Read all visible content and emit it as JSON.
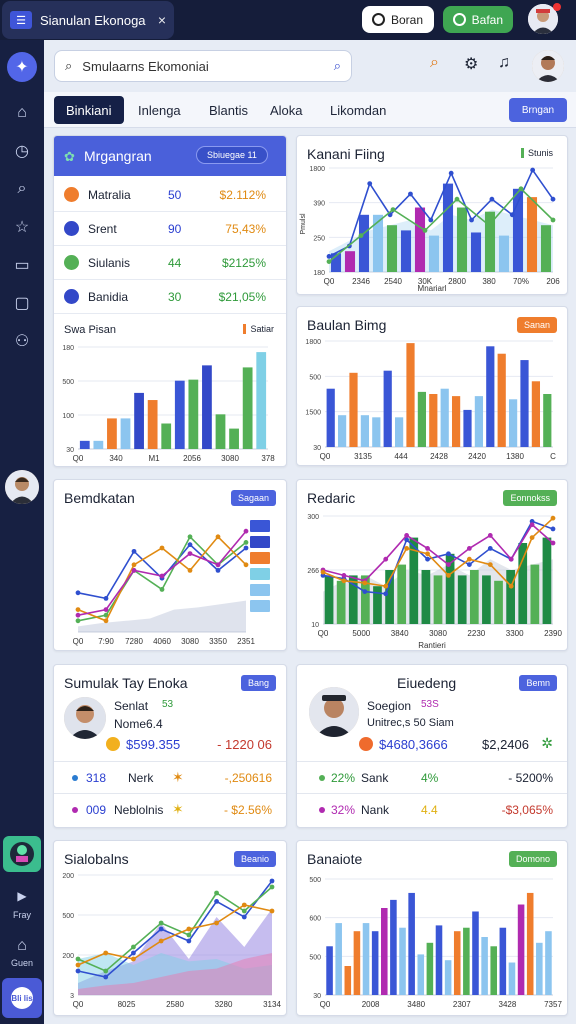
{
  "window": {
    "title": "Sianulan Ekonoga",
    "button_left": "Boran",
    "button_right": "Bafan",
    "icon_glyph": "☰",
    "close_glyph": "×"
  },
  "rail": {
    "labels": [
      "Fray",
      "Guen"
    ],
    "bottom": "Bli lis"
  },
  "search": {
    "value": "Smulaarns Ekomoniai"
  },
  "tabs": {
    "items": [
      "Binkiani",
      "Inlenga",
      "Blantis",
      "Aloka",
      "Likomdan"
    ],
    "button": "Brngan"
  },
  "card1": {
    "title": "Mrgangran",
    "badge": "Sbiuegae 11",
    "rows": [
      {
        "name": "Matralia",
        "value": "50",
        "pct": "$2.112%",
        "color": "#ef7d2d"
      },
      {
        "name": "Srent",
        "value": "90",
        "pct": "75,43%",
        "color": "#3348c8"
      },
      {
        "name": "Siulanis",
        "value": "44",
        "pct": "$2125%",
        "color": "#54b056"
      },
      {
        "name": "Banidia",
        "value": "30",
        "pct": "$21,05%",
        "color": "#3348c8"
      }
    ],
    "subtitle": "Swa Pisan",
    "legend": "Satiar"
  },
  "card2": {
    "title": "Kanani Fiing",
    "legend": "Stunis",
    "xlabel": "Mnariarl",
    "ylabel": "Pmulsl"
  },
  "card3": {
    "title": "Baulan Bimg",
    "badge": "Sanan"
  },
  "card4": {
    "title": "Bemdkatan",
    "badge": "Sagaan"
  },
  "card5": {
    "title": "Redaric",
    "badge": "Eonnokss",
    "xlabel": "Rantieri"
  },
  "card6": {
    "title": "Sumulak Tay Enoka",
    "badge": "Bang",
    "person": "Senlat",
    "person_tag": "53",
    "sub": "Nome6.4",
    "amount": "$599.355",
    "amount2": "- 1220 06",
    "rows": [
      {
        "v": "318",
        "n": "Nerk",
        "p": "-,250616",
        "color": "#2a7bd0"
      },
      {
        "v": "009",
        "n": "Neblolnis",
        "p": "- $2.56%",
        "color": "#b02ab0"
      }
    ]
  },
  "card7": {
    "title": "Eiuedeng",
    "badge": "Bemn",
    "person": "Soegion",
    "person_tag": "53S",
    "sub": "Unitrec,s 50 Siam",
    "amount": "$4680,3666",
    "amount2": "$2,2406",
    "rows": [
      {
        "v": "22%",
        "n": "Sank",
        "p2": "4%",
        "p": "- 5200%",
        "color": "#54b056"
      },
      {
        "v": "32%",
        "n": "Nank",
        "p2": "4.4",
        "p": "-$3,065%",
        "color": "#b02ab0"
      }
    ]
  },
  "card8": {
    "title": "Sialobalns",
    "badge": "Beanio"
  },
  "card9": {
    "title": "Banaiote",
    "badge": "Domono"
  },
  "chart_data": [
    {
      "id": "c1",
      "type": "bar",
      "title": "Swa Pisan",
      "yticks": [
        "180",
        "500",
        "100",
        "30"
      ],
      "xticks": [
        "Q0",
        "340",
        "M1",
        "2056",
        "3080",
        "378"
      ],
      "values": [
        0.08,
        0.08,
        0.3,
        0.3,
        0.55,
        0.48,
        0.25,
        0.67,
        0.68,
        0.82,
        0.34,
        0.2,
        0.8,
        0.95
      ],
      "colors": [
        "#3a56d6",
        "#8cc5ef",
        "#ef7d2d",
        "#8cc5ef",
        "#3348c8",
        "#ef7d2d",
        "#54b056",
        "#3a56d6",
        "#54b056",
        "#3348c8",
        "#54b056",
        "#54b056",
        "#54b056",
        "#7fd0e6"
      ]
    },
    {
      "id": "c2",
      "type": "bar",
      "title": "Kanani Fiing",
      "yticks": [
        "1800",
        "390",
        "250",
        "180"
      ],
      "xticks": [
        "Q0",
        "2346",
        "2540",
        "30K",
        "2800",
        "380",
        "70%",
        "206"
      ],
      "values": [
        0.18,
        0.2,
        0.55,
        0.55,
        0.45,
        0.4,
        0.62,
        0.35,
        0.85,
        0.62,
        0.38,
        0.58,
        0.35,
        0.8,
        0.72,
        0.45
      ],
      "colors": [
        "#3a56d6",
        "#b02ab0",
        "#3a56d6",
        "#8cc5ef",
        "#54b056",
        "#3a56d6",
        "#b02ab0",
        "#8cc5ef",
        "#3a56d6",
        "#54b056",
        "#3a56d6",
        "#54b056",
        "#8cc5ef",
        "#3a56d6",
        "#ef7d2d",
        "#54b056"
      ],
      "line": [
        0.15,
        0.25,
        0.85,
        0.55,
        0.75,
        0.5,
        0.95,
        0.5,
        0.7,
        0.55,
        0.98,
        0.7
      ],
      "line2": [
        0.1,
        0.35,
        0.6,
        0.4,
        0.7,
        0.45,
        0.8,
        0.5
      ]
    },
    {
      "id": "c3",
      "type": "bar",
      "title": "Baulan Bimg",
      "yticks": [
        "1800",
        "500",
        "1500",
        "30"
      ],
      "xticks": [
        "Q0",
        "3135",
        "444",
        "2428",
        "2420",
        "1380",
        "C"
      ],
      "values": [
        0.55,
        0.3,
        0.7,
        0.3,
        0.28,
        0.72,
        0.28,
        0.98,
        0.52,
        0.5,
        0.55,
        0.48,
        0.35,
        0.48,
        0.95,
        0.88,
        0.45,
        0.82,
        0.62,
        0.5
      ],
      "colors": [
        "#3a56d6",
        "#8cc5ef",
        "#ef7d2d",
        "#8cc5ef",
        "#8cc5ef",
        "#3a56d6",
        "#8cc5ef",
        "#ef7d2d",
        "#54b056",
        "#ef7d2d",
        "#8cc5ef",
        "#ef7d2d",
        "#3a56d6",
        "#8cc5ef",
        "#3a56d6",
        "#ef7d2d",
        "#8cc5ef",
        "#3a56d6",
        "#ef7d2d",
        "#54b056"
      ]
    },
    {
      "id": "c4",
      "type": "line",
      "title": "Bemdkatan",
      "xticks": [
        "Q0",
        "7:90",
        "7280",
        "4060",
        "3080",
        "3350",
        "2351"
      ],
      "series": [
        {
          "color": "#2f4fcf",
          "values": [
            0.35,
            0.3,
            0.72,
            0.48,
            0.78,
            0.55,
            0.75
          ]
        },
        {
          "color": "#54b056",
          "values": [
            0.1,
            0.15,
            0.55,
            0.38,
            0.85,
            0.6,
            0.8
          ]
        },
        {
          "color": "#e08a12",
          "values": [
            0.2,
            0.1,
            0.6,
            0.75,
            0.55,
            0.85,
            0.6
          ]
        },
        {
          "color": "#b02ab0",
          "values": [
            0.15,
            0.2,
            0.55,
            0.5,
            0.7,
            0.6,
            0.9
          ]
        }
      ],
      "area": [
        0.05,
        0.08,
        0.1,
        0.12,
        0.2,
        0.22,
        0.25,
        0.28
      ],
      "legend": [
        "#3a56d6",
        "#3348c8",
        "#ef7d2d",
        "#7fd0e6",
        "#8cc5ef",
        "#8cc5ef"
      ]
    },
    {
      "id": "c5",
      "type": "bar",
      "title": "Redaric",
      "yticks": [
        "300",
        "266",
        "10"
      ],
      "xticks": [
        "Q0",
        "5000",
        "3840",
        "3080",
        "2230",
        "3300",
        "2390"
      ],
      "values": [
        0.45,
        0.4,
        0.45,
        0.45,
        0.35,
        0.5,
        0.55,
        0.8,
        0.5,
        0.45,
        0.65,
        0.45,
        0.5,
        0.45,
        0.4,
        0.5,
        0.75,
        0.55,
        0.8
      ],
      "colors": [
        "#1f8a45",
        "#54b056",
        "#1f8a45",
        "#54b056",
        "#1f8a45",
        "#1f8a45",
        "#54b056",
        "#1f8a45",
        "#1f8a45",
        "#54b056",
        "#1f8a45",
        "#1f8a45",
        "#54b056",
        "#1f8a45",
        "#54b056",
        "#1f8a45",
        "#1f8a45",
        "#54b056",
        "#1f8a45"
      ],
      "series": [
        {
          "color": "#2f4fcf",
          "values": [
            0.45,
            0.42,
            0.3,
            0.28,
            0.78,
            0.6,
            0.65,
            0.55,
            0.7,
            0.6,
            0.95,
            0.88
          ]
        },
        {
          "color": "#b02ab0",
          "values": [
            0.5,
            0.45,
            0.4,
            0.6,
            0.82,
            0.7,
            0.55,
            0.7,
            0.82,
            0.6,
            0.92,
            0.75
          ]
        },
        {
          "color": "#e08a12",
          "values": [
            0.48,
            0.4,
            0.38,
            0.35,
            0.7,
            0.65,
            0.45,
            0.6,
            0.55,
            0.35,
            0.8,
            0.98
          ]
        }
      ]
    },
    {
      "id": "c6",
      "type": "line",
      "title": "Sialobalns",
      "yticks": [
        "200",
        "500",
        "200",
        "3"
      ],
      "xticks": [
        "Q0",
        "8025",
        "2580",
        "3280",
        "3134"
      ],
      "series": [
        {
          "color": "#2f4fcf",
          "values": [
            0.2,
            0.15,
            0.35,
            0.55,
            0.45,
            0.78,
            0.65,
            0.95
          ]
        },
        {
          "color": "#54b056",
          "values": [
            0.3,
            0.2,
            0.4,
            0.6,
            0.5,
            0.85,
            0.7,
            0.9
          ]
        },
        {
          "color": "#e08a12",
          "values": [
            0.25,
            0.35,
            0.3,
            0.45,
            0.55,
            0.6,
            0.75,
            0.7
          ]
        }
      ],
      "areas": [
        {
          "color": "#8e7be0",
          "values": [
            0.1,
            0.2,
            0.28,
            0.6,
            0.3,
            0.65,
            0.4,
            0.72
          ]
        },
        {
          "color": "#7fd0e6",
          "values": [
            0.3,
            0.35,
            0.25,
            0.35,
            0.28,
            0.3,
            0.22,
            0.25
          ]
        },
        {
          "color": "#e879b0",
          "values": [
            0.05,
            0.08,
            0.1,
            0.15,
            0.2,
            0.22,
            0.3,
            0.35
          ]
        }
      ]
    },
    {
      "id": "c7",
      "type": "bar",
      "title": "Banaiote",
      "yticks": [
        "500",
        "600",
        "500",
        "30"
      ],
      "xticks": [
        "Q0",
        "2008",
        "3480",
        "2307",
        "3428",
        "7357"
      ],
      "values": [
        0.42,
        0.62,
        0.25,
        0.55,
        0.62,
        0.55,
        0.75,
        0.82,
        0.58,
        0.88,
        0.35,
        0.45,
        0.6,
        0.3,
        0.55,
        0.58,
        0.72,
        0.5,
        0.42,
        0.58,
        0.28,
        0.78,
        0.88,
        0.45,
        0.55
      ],
      "colors": [
        "#3a56d6",
        "#8cc5ef",
        "#ef7d2d",
        "#ef7d2d",
        "#8cc5ef",
        "#3a56d6",
        "#b02ab0",
        "#3a56d6",
        "#8cc5ef",
        "#3a56d6",
        "#8cc5ef",
        "#54b056",
        "#3a56d6",
        "#8cc5ef",
        "#ef7d2d",
        "#54b056",
        "#3a56d6",
        "#8cc5ef",
        "#54b056",
        "#3a56d6",
        "#8cc5ef",
        "#b02ab0",
        "#ef7d2d",
        "#8cc5ef",
        "#8cc5ef"
      ]
    }
  ]
}
